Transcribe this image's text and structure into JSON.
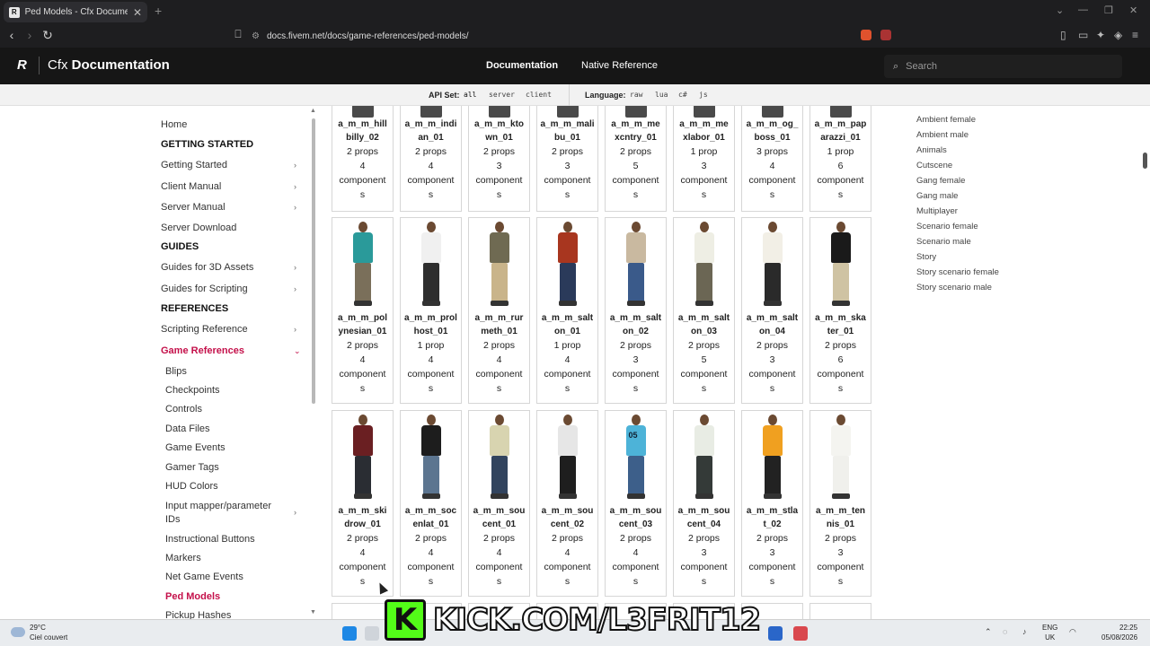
{
  "browser": {
    "tab_title": "Ped Models - Cfx Documentation",
    "tab_favicon": "R",
    "url": "docs.fivem.net/docs/game-references/ped-models/"
  },
  "header": {
    "logo": "R",
    "brand_light": "Cfx",
    "brand_bold": "Documentation",
    "nav": [
      "Documentation",
      "Native Reference"
    ],
    "search_placeholder": "Search"
  },
  "apibar": {
    "api_label": "API Set:",
    "api_options": [
      "all",
      "server",
      "client"
    ],
    "lang_label": "Language:",
    "lang_options": [
      "raw",
      "lua",
      "c#",
      "js"
    ]
  },
  "sidebar": {
    "items": [
      {
        "label": "Home"
      },
      {
        "label": "GETTING STARTED"
      },
      {
        "label": "Getting Started"
      },
      {
        "label": "Client Manual"
      },
      {
        "label": "Server Manual"
      },
      {
        "label": "Server Download"
      },
      {
        "label": "GUIDES"
      },
      {
        "label": "Guides for 3D Assets"
      },
      {
        "label": "Guides for Scripting"
      },
      {
        "label": "REFERENCES"
      },
      {
        "label": "Scripting Reference"
      },
      {
        "label": "Game References"
      },
      {
        "label": "Blips"
      },
      {
        "label": "Checkpoints"
      },
      {
        "label": "Controls"
      },
      {
        "label": "Data Files"
      },
      {
        "label": "Game Events"
      },
      {
        "label": "Gamer Tags"
      },
      {
        "label": "HUD Colors"
      },
      {
        "label": "Input mapper/parameter IDs"
      },
      {
        "label": "Instructional Buttons"
      },
      {
        "label": "Markers"
      },
      {
        "label": "Net Game Events"
      },
      {
        "label": "Ped Models"
      },
      {
        "label": "Pickup Hashes"
      }
    ]
  },
  "peds": {
    "row1": [
      {
        "name": "a_m_m_hill billy_02",
        "props": "2 props",
        "comp": "4",
        "word": "component",
        "s": "s"
      },
      {
        "name": "a_m_m_indi an_01",
        "props": "2 props",
        "comp": "4",
        "word": "component",
        "s": "s"
      },
      {
        "name": "a_m_m_kto wn_01",
        "props": "2 props",
        "comp": "3",
        "word": "component",
        "s": "s"
      },
      {
        "name": "a_m_m_mali bu_01",
        "props": "2 props",
        "comp": "3",
        "word": "component",
        "s": "s"
      },
      {
        "name": "a_m_m_me xcntry_01",
        "props": "2 props",
        "comp": "5",
        "word": "component",
        "s": "s"
      },
      {
        "name": "a_m_m_me xlabor_01",
        "props": "1 prop",
        "comp": "3",
        "word": "component",
        "s": "s"
      },
      {
        "name": "a_m_m_og_ boss_01",
        "props": "3 props",
        "comp": "4",
        "word": "component",
        "s": "s"
      },
      {
        "name": "a_m_m_pap arazzi_01",
        "props": "1 prop",
        "comp": "6",
        "word": "component",
        "s": "s"
      }
    ],
    "row2": [
      {
        "name": "a_m_m_pol ynesian_01",
        "props": "2 props",
        "comp": "4",
        "word": "component",
        "s": "s"
      },
      {
        "name": "a_m_m_prol host_01",
        "props": "1 prop",
        "comp": "4",
        "word": "component",
        "s": "s"
      },
      {
        "name": "a_m_m_rur meth_01",
        "props": "2 props",
        "comp": "4",
        "word": "component",
        "s": "s"
      },
      {
        "name": "a_m_m_salt on_01",
        "props": "1 prop",
        "comp": "4",
        "word": "component",
        "s": "s"
      },
      {
        "name": "a_m_m_salt on_02",
        "props": "2 props",
        "comp": "3",
        "word": "component",
        "s": "s"
      },
      {
        "name": "a_m_m_salt on_03",
        "props": "2 props",
        "comp": "5",
        "word": "component",
        "s": "s"
      },
      {
        "name": "a_m_m_salt on_04",
        "props": "2 props",
        "comp": "3",
        "word": "component",
        "s": "s"
      },
      {
        "name": "a_m_m_ska ter_01",
        "props": "2 props",
        "comp": "6",
        "word": "component",
        "s": "s"
      }
    ],
    "row3": [
      {
        "name": "a_m_m_ski drow_01",
        "props": "2 props",
        "comp": "4",
        "word": "component",
        "s": "s"
      },
      {
        "name": "a_m_m_soc enlat_01",
        "props": "2 props",
        "comp": "4",
        "word": "component",
        "s": "s"
      },
      {
        "name": "a_m_m_sou cent_01",
        "props": "2 props",
        "comp": "4",
        "word": "component",
        "s": "s"
      },
      {
        "name": "a_m_m_sou cent_02",
        "props": "2 props",
        "comp": "4",
        "word": "component",
        "s": "s"
      },
      {
        "name": "a_m_m_sou cent_03",
        "props": "2 props",
        "comp": "4",
        "word": "component",
        "s": "s"
      },
      {
        "name": "a_m_m_sou cent_04",
        "props": "2 props",
        "comp": "3",
        "word": "component",
        "s": "s"
      },
      {
        "name": "a_m_m_stla t_02",
        "props": "2 props",
        "comp": "3",
        "word": "component",
        "s": "s"
      },
      {
        "name": "a_m_m_ten nis_01",
        "props": "2 props",
        "comp": "3",
        "word": "component",
        "s": "s"
      }
    ],
    "row2_colors": [
      [
        "#2a9a9a",
        "#7a6f5a"
      ],
      [
        "#f0f0f0",
        "#2e2e2e"
      ],
      [
        "#6f6a52",
        "#c9b48a"
      ],
      [
        "#a8361f",
        "#2a3a5a"
      ],
      [
        "#c9b9a0",
        "#3a5a8a"
      ],
      [
        "#eeeee4",
        "#6b6654"
      ],
      [
        "#f2efe6",
        "#2a2a2a"
      ],
      [
        "#1a1a1a",
        "#cfc3a3"
      ]
    ],
    "row3_colors": [
      [
        "#6a1f22",
        "#2a2d33"
      ],
      [
        "#1d1d1d",
        "#5c7590"
      ],
      [
        "#d8d4b0",
        "#32445e"
      ],
      [
        "#e6e6e6",
        "#1e1e1e"
      ],
      [
        "#4db3d8",
        "#3d5f8a"
      ],
      [
        "#e8ece4",
        "#343a38"
      ],
      [
        "#f0a020",
        "#222222"
      ],
      [
        "#f4f4f0",
        "#f0f0ec"
      ]
    ],
    "row3_jersey": "05"
  },
  "toc": [
    "Ambient female",
    "Ambient male",
    "Animals",
    "Cutscene",
    "Gang female",
    "Gang male",
    "Multiplayer",
    "Scenario female",
    "Scenario male",
    "Story",
    "Story scenario female",
    "Story scenario male"
  ],
  "taskbar": {
    "temp": "29°C",
    "weather": "Ciel couvert",
    "lang1": "ENG",
    "lang2": "UK",
    "time": "22:25",
    "date": "05/08/2026"
  },
  "overlay": {
    "k": "K",
    "text": "KICK.COM/L3FRIT12"
  },
  "colors": {
    "accent": "#c4104a",
    "kick_green": "#53fc18"
  }
}
